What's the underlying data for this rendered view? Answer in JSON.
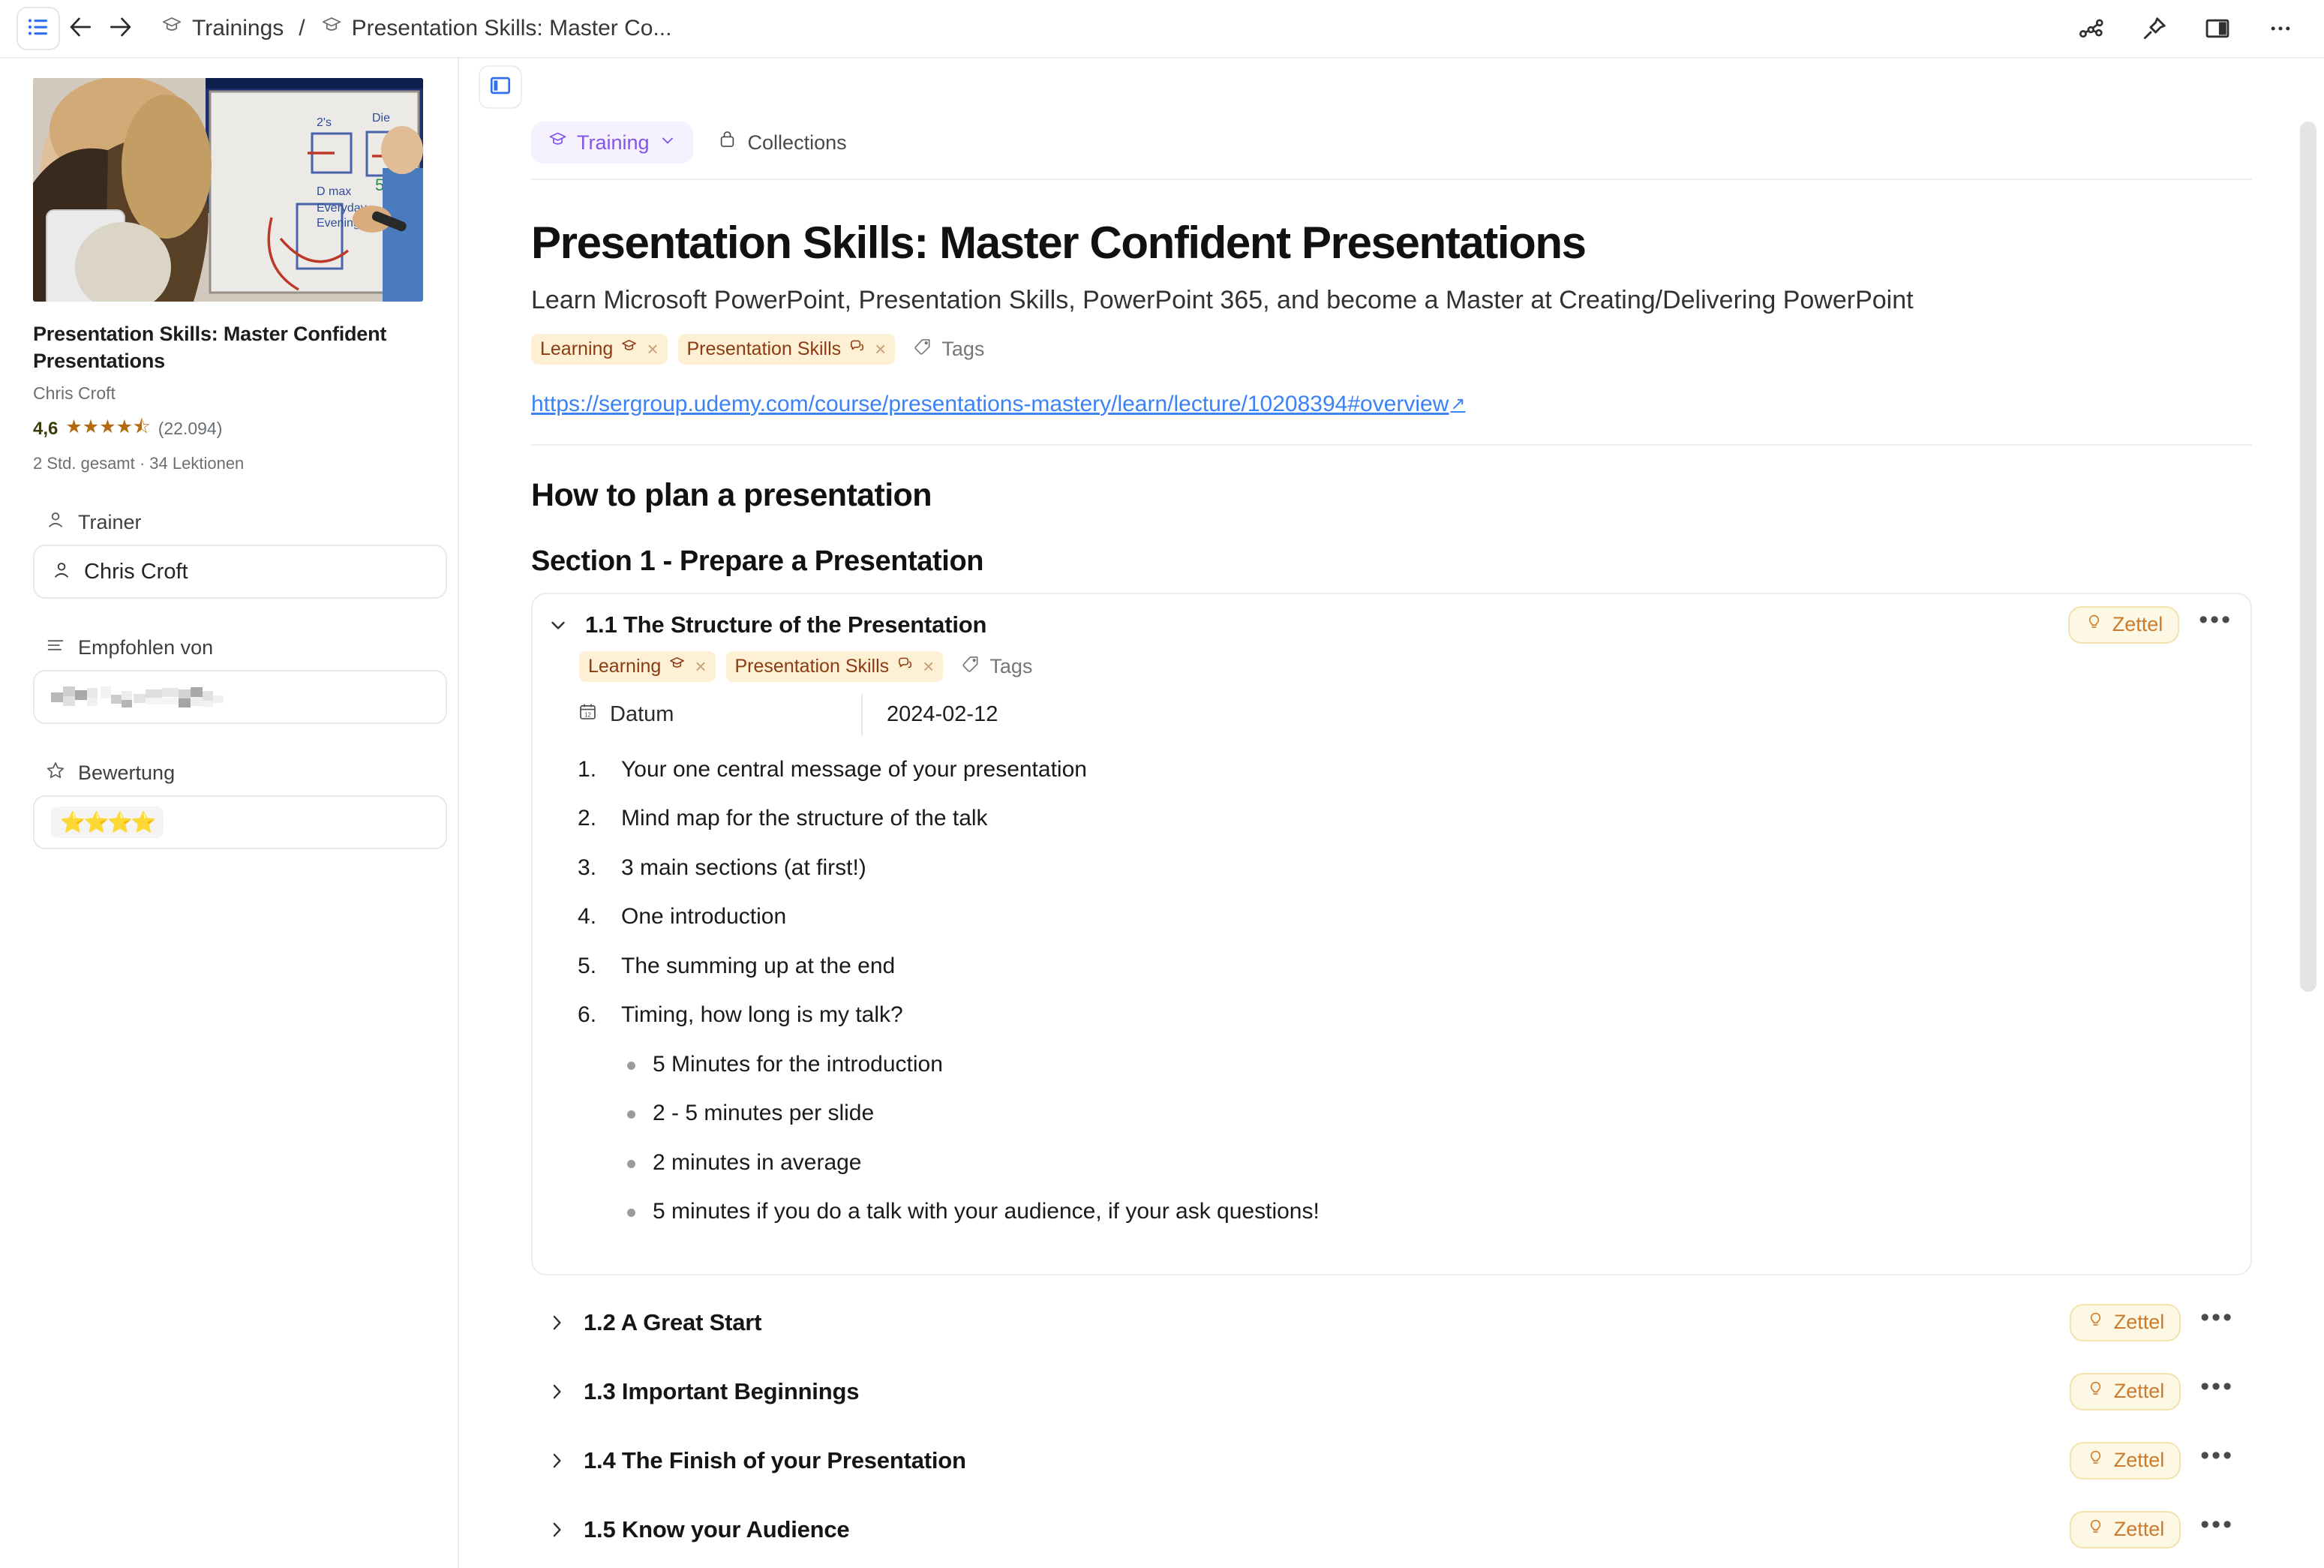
{
  "titlebar": {
    "hamburger_icon": "list-menu-icon",
    "back_icon": "arrow-left-icon",
    "forward_icon": "arrow-right-icon",
    "breadcrumb": [
      {
        "icon": "graduation-cap-icon",
        "label": "Trainings"
      },
      {
        "icon": "graduation-cap-icon",
        "label": "Presentation Skills: Master Co..."
      }
    ],
    "separator": "/",
    "right_icons": [
      {
        "name": "graph-view-icon"
      },
      {
        "name": "pin-icon"
      },
      {
        "name": "split-pane-icon"
      },
      {
        "name": "more-options-icon",
        "glyph": "•••"
      }
    ]
  },
  "sidebar": {
    "course_card": {
      "title": "Presentation Skills: Master Confident Presentations",
      "author": "Chris Croft",
      "rating_value": "4,6",
      "rating_stars": "★★★★⯪",
      "rating_count": "(22.094)",
      "meta": "2 Std. gesamt · 34 Lektionen"
    },
    "properties": [
      {
        "icon": "person-icon",
        "label": "Trainer",
        "value": "Chris Croft",
        "value_icon": "person-icon",
        "type": "person"
      },
      {
        "icon": "text-lines-icon",
        "label": "Empfohlen von",
        "value": "",
        "type": "redacted"
      },
      {
        "icon": "star-outline-icon",
        "label": "Bewertung",
        "value": "⭐⭐⭐⭐",
        "type": "stars"
      }
    ]
  },
  "main": {
    "panel_toggle_icon": "toggle-left-panel-icon",
    "tabs": [
      {
        "icon": "graduation-cap-icon",
        "label": "Training",
        "active": true,
        "chevron": "chevron-down-icon"
      },
      {
        "icon": "collections-icon",
        "label": "Collections",
        "active": false
      }
    ],
    "document": {
      "title": "Presentation Skills: Master Confident Presentations",
      "subtitle": "Learn Microsoft PowerPoint, Presentation Skills, PowerPoint 365, and become a Master at Creating/Delivering PowerPoint",
      "tags": [
        {
          "label": "Learning",
          "icon": "graduation-cap-icon",
          "remove": "×"
        },
        {
          "label": "Presentation Skills",
          "icon": "speech-bubbles-icon",
          "remove": "×"
        }
      ],
      "tags_placeholder": "Tags",
      "tags_placeholder_icon": "tag-icon",
      "link": "https://sergroup.udemy.com/course/presentations-mastery/learn/lecture/10208394#overview",
      "link_external_glyph": "↗",
      "heading_h2": "How to plan a presentation",
      "heading_h3": "Section 1 - Prepare a Presentation",
      "lessons": [
        {
          "title": "1.1 The Structure of the Presentation",
          "expanded": true,
          "chevron": "chevron-down-icon",
          "badge": {
            "label": "Zettel",
            "icon": "lightbulb-icon"
          },
          "menu_glyph": "•••",
          "tags": [
            {
              "label": "Learning",
              "icon": "graduation-cap-icon",
              "remove": "×"
            },
            {
              "label": "Presentation Skills",
              "icon": "speech-bubbles-icon",
              "remove": "×"
            }
          ],
          "tags_placeholder": "Tags",
          "property": {
            "icon": "calendar-icon",
            "key": "Datum",
            "value": "2024-02-12"
          },
          "numbered_items": [
            "Your one central message of your presentation",
            "Mind map for the structure of the talk",
            "3 main sections (at first!)",
            "One introduction",
            "The summing up at the end",
            "Timing, how long is my talk?"
          ],
          "bullets_level1": [
            "5 Minutes for the introduction",
            "2 - 5 minutes per slide"
          ],
          "bullets_level2": [
            "2 minutes in average",
            "5 minutes if you do a talk with your audience, if your ask questions!"
          ]
        },
        {
          "title": "1.2 A Great Start",
          "expanded": false,
          "chevron": "chevron-right-icon",
          "badge": {
            "label": "Zettel",
            "icon": "lightbulb-icon"
          },
          "menu_glyph": "•••"
        },
        {
          "title": "1.3 Important Beginnings",
          "expanded": false,
          "chevron": "chevron-right-icon",
          "badge": {
            "label": "Zettel",
            "icon": "lightbulb-icon"
          },
          "menu_glyph": "•••"
        },
        {
          "title": "1.4 The Finish of your Presentation",
          "expanded": false,
          "chevron": "chevron-right-icon",
          "badge": {
            "label": "Zettel",
            "icon": "lightbulb-icon"
          },
          "menu_glyph": "•••"
        },
        {
          "title": "1.5 Know your Audience",
          "expanded": false,
          "chevron": "chevron-right-icon",
          "badge": {
            "label": "Zettel",
            "icon": "lightbulb-icon"
          },
          "menu_glyph": "•••"
        }
      ]
    }
  },
  "colors": {
    "accent_purple": "#8356e8",
    "tag_bg": "#fdf0d5",
    "tag_text": "#8a3b12",
    "zettel_bg": "#fdf8e3",
    "zettel_text": "#cb7a2e",
    "link_blue": "#3b82f6",
    "rating_gold": "#b4690e"
  }
}
